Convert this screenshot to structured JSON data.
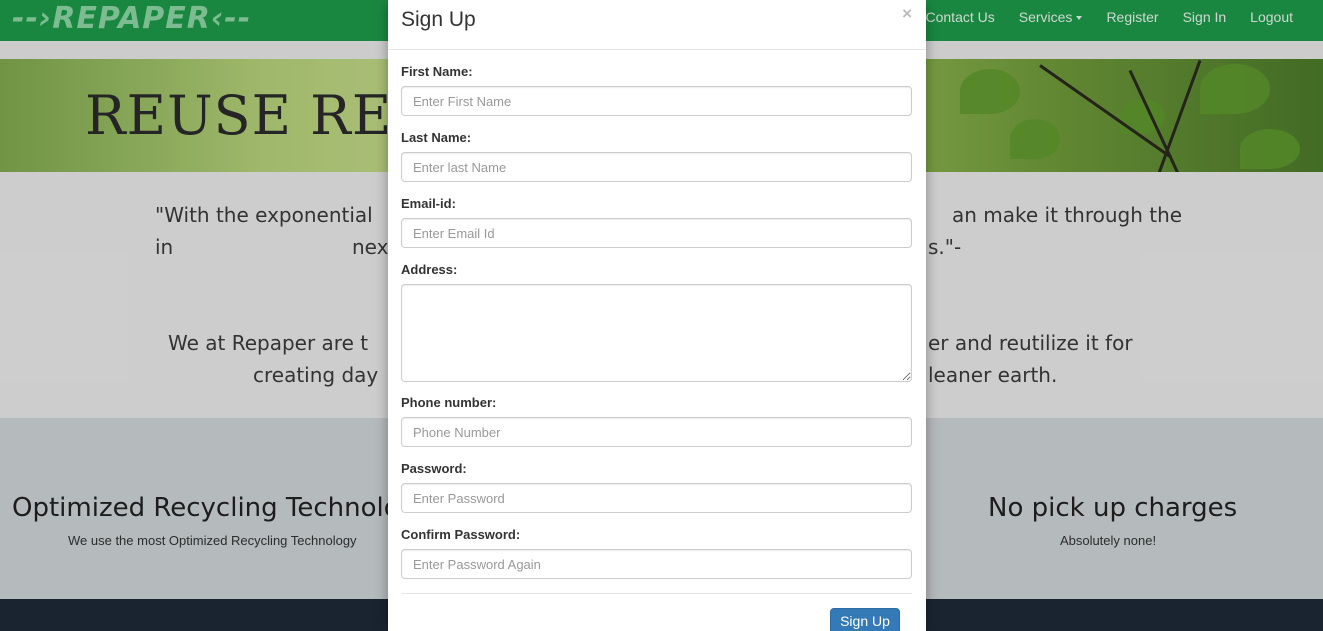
{
  "navbar": {
    "logo_text": "--›REPAPER‹--",
    "links": [
      "Contact Us",
      "Services",
      "Register",
      "Sign In",
      "Logout"
    ]
  },
  "hero": {
    "title": "REUSE REDUC"
  },
  "quotes": {
    "line1": "\"With the exponential in",
    "line1_right": "an make it through the",
    "line2": "nex",
    "line2_right": "s.\"-",
    "line3": "We at Repaper are t",
    "line3_right": "er and reutilize it for",
    "line4": "creating day",
    "line4_right": "leaner earth."
  },
  "features": {
    "left_title": "Optimized Recycling Technology",
    "left_sub": "We use the most Optimized Recycling Technology",
    "right_title": "No pick up charges",
    "right_sub": "Absolutely none!"
  },
  "modal": {
    "title": "Sign Up",
    "close": "×",
    "first_name_label": "First Name:",
    "first_name_placeholder": "Enter First Name",
    "last_name_label": "Last Name:",
    "last_name_placeholder": "Enter last Name",
    "email_label": "Email-id:",
    "email_placeholder": "Enter Email Id",
    "address_label": "Address:",
    "phone_label": "Phone number:",
    "phone_placeholder": "Phone Number",
    "password_label": "Password:",
    "password_placeholder": "Enter Password",
    "confirm_label": "Confirm Password:",
    "confirm_placeholder": "Enter Password Again",
    "submit": "Sign Up"
  },
  "colors": {
    "navbar": "#1e9a4a",
    "primary_button": "#337ab7",
    "footer": "#1e2a38"
  }
}
